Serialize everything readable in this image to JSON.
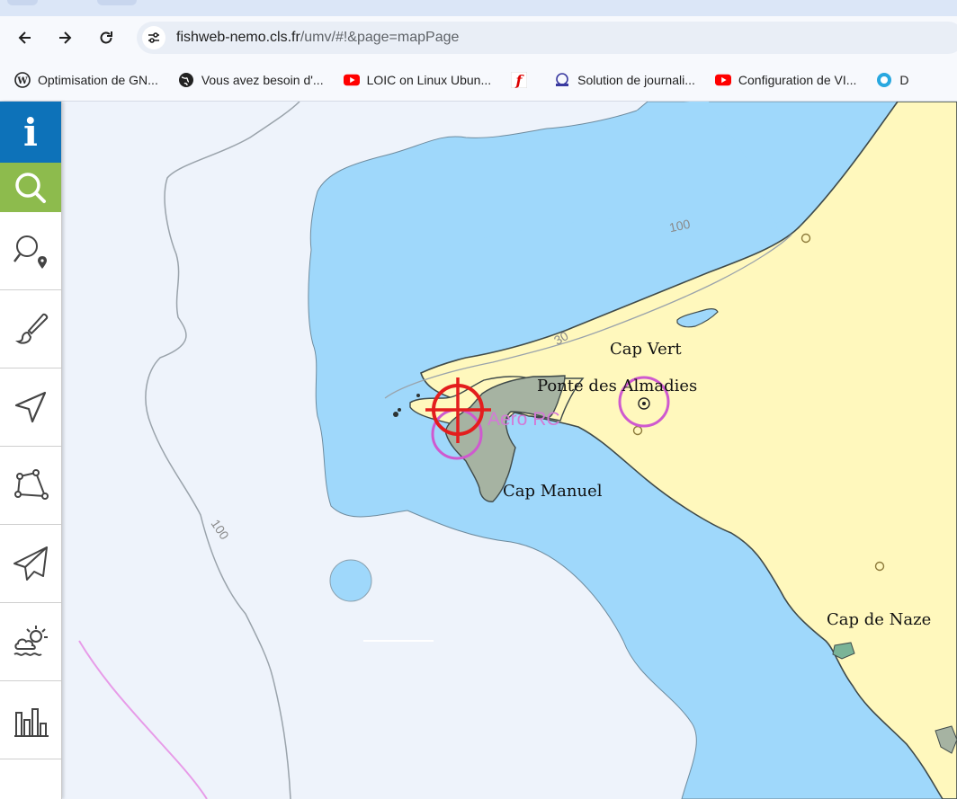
{
  "browser": {
    "url_host": "fishweb-nemo.cls.fr",
    "url_path": "/umv/#!&page=mapPage",
    "bookmarks": [
      {
        "label": "Optimisation de GN...",
        "icon": "wordpress-icon"
      },
      {
        "label": "Vous avez besoin d'...",
        "icon": "globe-icon"
      },
      {
        "label": "LOIC on Linux Ubun...",
        "icon": "youtube-icon"
      },
      {
        "label": "",
        "icon": "flash-icon"
      },
      {
        "label": "Solution de journali...",
        "icon": "site-logo-icon"
      },
      {
        "label": "Configuration de VI...",
        "icon": "youtube-icon"
      },
      {
        "label": "D",
        "icon": "blue-circle-icon"
      }
    ]
  },
  "sidebar": {
    "info_label": "i",
    "tools": [
      "search-icon",
      "search-location-icon",
      "brush-icon",
      "navigation-arrow-icon",
      "polygon-icon",
      "paper-plane-icon",
      "weather-icon",
      "bar-chart-icon"
    ]
  },
  "map": {
    "labels": {
      "cap_vert": "Cap Vert",
      "pointe_almadies": "Ponte des Almadies",
      "aero_rc": "Aero RC",
      "cap_manuel": "Cap Manuel",
      "cap_naze": "Cap de Naze"
    },
    "depth_labels": {
      "d100_top": "100",
      "d30": "30",
      "d100_left": "100"
    },
    "colors": {
      "deep_sea": "#eef3fb",
      "shallow_sea": "#9fd8fb",
      "land": "#fff8bd",
      "urban": "#a6b3a2",
      "crosshair": "#e31d1d",
      "aero_circle": "#cf59cf"
    }
  }
}
